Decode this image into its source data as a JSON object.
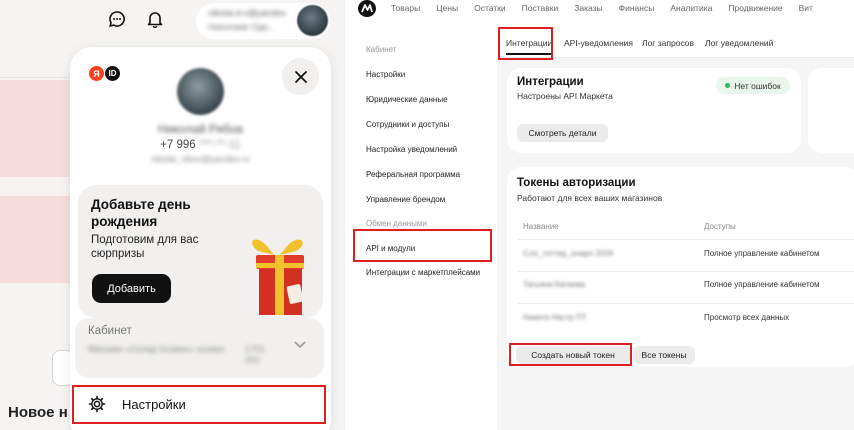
{
  "left": {
    "user": {
      "name_short": "nikolai.d.v@yandex",
      "name_sub": "Николаев Оде...",
      "full_name": "Николай Рябов",
      "phone_prefix": "+7 996",
      "phone_rest": " ***-**-11",
      "email": "nikolai_ribov@yandex.ru"
    },
    "popup": {
      "logo_ya": "Я",
      "logo_id": "ID",
      "birthday_title": "Добавьте день рождения",
      "birthday_sub": "Подготовим для вас сюрпризы",
      "birthday_button": "Добавить",
      "cabinet_label": "Кабинет",
      "cabinet_value": "Магазин «Склад Хозяин» хозяин",
      "cabinet_value2": "1701 001",
      "settings_label": "Настройки"
    },
    "page_heading": "Новое н"
  },
  "right": {
    "nav": [
      "Товары",
      "Цены",
      "Остатки",
      "Поставки",
      "Заказы",
      "Финансы",
      "Аналитика",
      "Продвижение",
      "Вит"
    ],
    "sidebar": {
      "header1": "Кабинет",
      "items1": [
        "Настройки",
        "Юридические данные",
        "Сотрудники и доступы",
        "Настройка уведомлений",
        "Реферальная программа",
        "Управление брендом"
      ],
      "header2": "Обмен данными",
      "items2": [
        "API и модули",
        "Интеграции с маркетплейсами"
      ]
    },
    "tabs": [
      "Интеграции",
      "API-уведомления",
      "Лог запросов",
      "Лог уведомлений"
    ],
    "integrations_card": {
      "title": "Интеграции",
      "subtitle": "Настроены API Маркета",
      "badge": "Нет ошибок",
      "button": "Смотреть детали"
    },
    "tokens_card": {
      "title": "Токены авторизации",
      "subtitle": "Работают для всех ваших магазинов",
      "columns": [
        "Название",
        "Доступы"
      ],
      "rows": [
        {
          "name": "Сло_тоттер_онаро 2024",
          "access": "Полное управление кабинетом"
        },
        {
          "name": "Татьяна Катаева",
          "access": "Полное управление кабинетом"
        },
        {
          "name": "Никита Настр ПТ",
          "access": "Просмотр всех данных"
        }
      ],
      "create_button": "Создать новый токен",
      "all_button": "Все токены"
    }
  },
  "colors": {
    "highlight": "#e02020",
    "ok_green": "#2fb45a",
    "yandex_red": "#fc3f1d"
  }
}
